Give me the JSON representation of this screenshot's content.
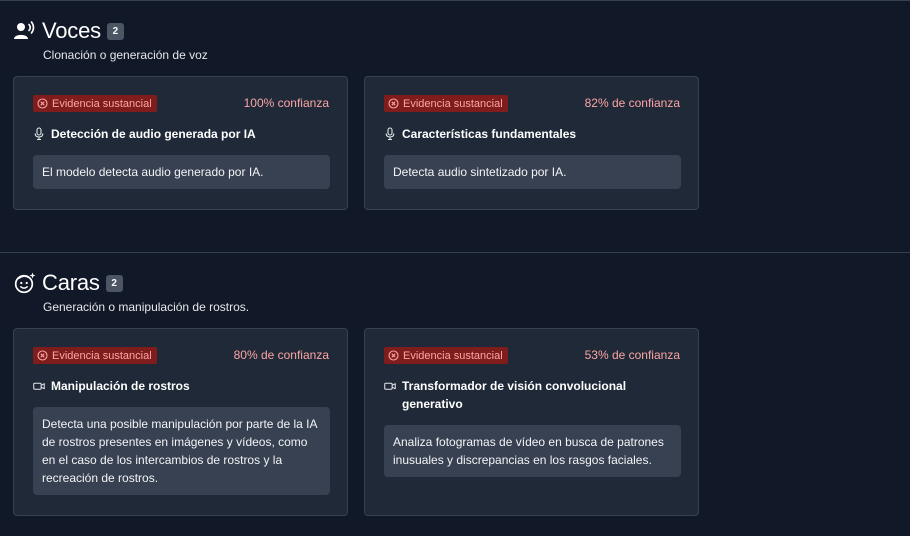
{
  "sections": [
    {
      "icon": "voice-icon",
      "title": "Voces",
      "count": "2",
      "subtitle": "Clonación o generación de voz",
      "cards": [
        {
          "badge": "Evidencia sustancial",
          "confidence": "100% confianza",
          "feature_icon": "microphone-icon",
          "feature": "Detección de audio generada por IA",
          "description": "El modelo detecta audio generado por IA."
        },
        {
          "badge": "Evidencia sustancial",
          "confidence": "82% de confianza",
          "feature_icon": "microphone-icon",
          "feature": "Características fundamentales",
          "description": "Detecta audio sintetizado por IA."
        }
      ]
    },
    {
      "icon": "face-icon",
      "title": "Caras",
      "count": "2",
      "subtitle": "Generación o manipulación de rostros.",
      "cards": [
        {
          "badge": "Evidencia sustancial",
          "confidence": "80% de confianza",
          "feature_icon": "video-icon",
          "feature": "Manipulación de rostros",
          "description": "Detecta una posible manipulación por parte de la IA de rostros presentes en imágenes y vídeos, como en el caso de los intercambios de rostros y la recreación de rostros."
        },
        {
          "badge": "Evidencia sustancial",
          "confidence": "53% de confianza",
          "feature_icon": "video-icon",
          "feature": "Transformador de visión convolucional generativo",
          "description": "Analiza fotogramas de vídeo en busca de patrones inusuales y discrepancias en los rasgos faciales."
        }
      ]
    }
  ],
  "colors": {
    "background": "#111827",
    "card": "#1f2937",
    "badge_bg": "#7f1d1d",
    "badge_text": "#fca5a5",
    "confidence_text": "#fca5a5"
  }
}
